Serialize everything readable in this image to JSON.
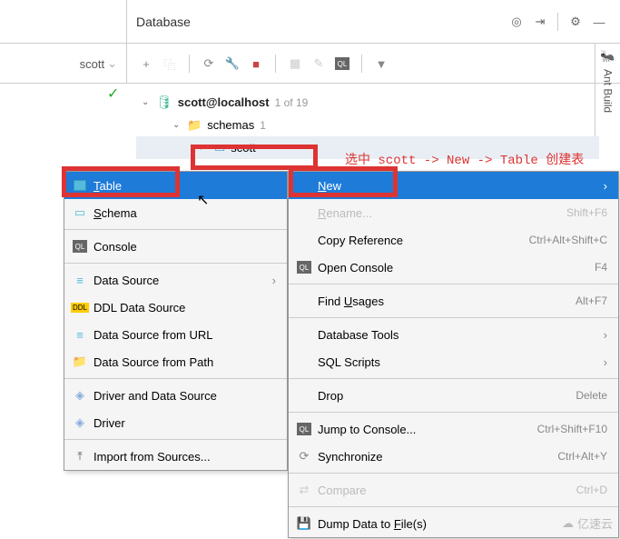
{
  "header": {
    "title": "Database"
  },
  "chip": {
    "label": "scott"
  },
  "tree": {
    "root_label": "scott@localhost",
    "root_count": "1 of 19",
    "schemas_label": "schemas",
    "schemas_count": "1",
    "db_label": "scott"
  },
  "annotation": "选中 scott -> New -> Table 创建表",
  "menu1": [
    {
      "label": "Table",
      "icon": "table",
      "u": "T"
    },
    {
      "label": "Schema",
      "icon": "schema",
      "u": "S"
    },
    {
      "sep": true
    },
    {
      "label": "Console",
      "icon": "ql"
    },
    {
      "sep": true
    },
    {
      "label": "Data Source",
      "icon": "ds",
      "arrow": true
    },
    {
      "label": "DDL Data Source",
      "icon": "ddl"
    },
    {
      "label": "Data Source from URL",
      "icon": "dsurl"
    },
    {
      "label": "Data Source from Path",
      "icon": "folder"
    },
    {
      "sep": true
    },
    {
      "label": "Driver and Data Source",
      "icon": "drv"
    },
    {
      "label": "Driver",
      "icon": "drv"
    },
    {
      "sep": true
    },
    {
      "label": "Import from Sources...",
      "icon": "import"
    }
  ],
  "menu2": [
    {
      "label": "New",
      "u": "N",
      "arrow": true,
      "sel": true
    },
    {
      "label": "Rename...",
      "u": "R",
      "short": "Shift+F6",
      "dis": true
    },
    {
      "label": "Copy Reference",
      "short": "Ctrl+Alt+Shift+C"
    },
    {
      "label": "Open Console",
      "icon": "ql",
      "short": "F4"
    },
    {
      "sep": true
    },
    {
      "label": "Find Usages",
      "u": "U",
      "short": "Alt+F7"
    },
    {
      "sep": true
    },
    {
      "label": "Database Tools",
      "arrow": true
    },
    {
      "label": "SQL Scripts",
      "arrow": true
    },
    {
      "sep": true
    },
    {
      "label": "Drop",
      "short": "Delete"
    },
    {
      "sep": true
    },
    {
      "label": "Jump to Console...",
      "icon": "ql",
      "short": "Ctrl+Shift+F10"
    },
    {
      "label": "Synchronize",
      "icon": "sync",
      "short": "Ctrl+Alt+Y"
    },
    {
      "sep": true
    },
    {
      "label": "Compare",
      "icon": "diff",
      "short": "Ctrl+D",
      "dis": true
    },
    {
      "sep": true
    },
    {
      "label": "Dump Data to File(s)",
      "icon": "save",
      "u": "F"
    }
  ],
  "sidebar": {
    "label": "Ant Build"
  },
  "watermark": "亿速云"
}
